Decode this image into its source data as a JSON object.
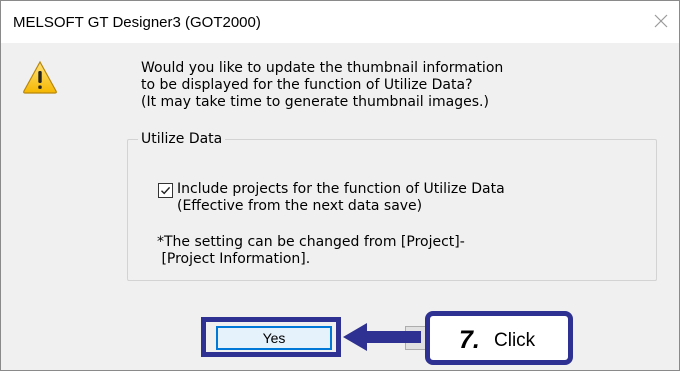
{
  "dialog": {
    "title": "MELSOFT GT Designer3 (GOT2000)",
    "message": "Would you like to update the thumbnail information\nto be displayed for the function of Utilize Data?\n(It may take time to generate thumbnail images.)",
    "icon": "warning-icon"
  },
  "utilize_group": {
    "legend": "Utilize Data",
    "checkbox_checked": true,
    "checkbox_label": "Include projects for the function of Utilize Data\n(Effective from the next data save)",
    "note": "*The setting can be changed from [Project]-\n [Project Information]."
  },
  "buttons": {
    "yes_label": "Yes"
  },
  "callout": {
    "step": "7.",
    "action": "Click",
    "color": "#2e3192"
  }
}
